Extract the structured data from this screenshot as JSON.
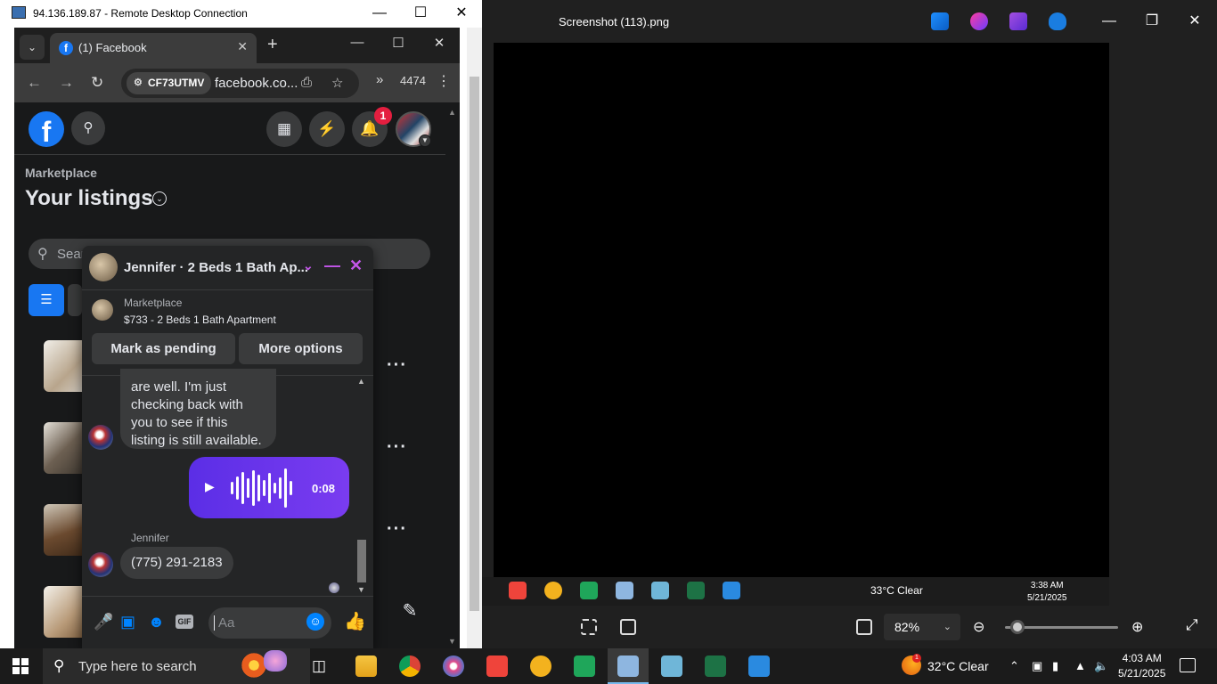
{
  "photos": {
    "title": "Screenshot (113).png",
    "zoom": "82%",
    "zoom_level": 0.1
  },
  "rdp": {
    "title": "94.136.189.87 - Remote Desktop Connection"
  },
  "chrome": {
    "tab_title": "(1) Facebook",
    "chip_label": "CF73UTMV",
    "url": "facebook.co...",
    "ext_count": "4474"
  },
  "fb": {
    "notification_count": "1",
    "breadcrumb": "Marketplace",
    "page_title": "Your listings",
    "search_placeholder": "Sear"
  },
  "chat": {
    "name": "Jennifer · 2 Beds 1 Bath Ap...",
    "marketplace_label": "Marketplace",
    "listing_title": "$733 - 2 Beds 1 Bath Apartment",
    "mark_pending": "Mark as pending",
    "more_options": "More options",
    "messages": [
      {
        "line1": "are well.  I'm just",
        "line2": "checking back with",
        "line3": "you to see if this",
        "line4": "listing is still available."
      }
    ],
    "voice_duration": "0:08",
    "sender_name": "Jennifer",
    "phone_message": "(775) 291-2183",
    "composer_placeholder": "Aa"
  },
  "inner_taskbar": {
    "weather": "33°C  Clear",
    "time": "3:38 AM",
    "date": "5/21/2025"
  },
  "taskbar": {
    "search_placeholder": "Type here to search",
    "weather": "32°C  Clear",
    "time": "4:03 AM",
    "date": "5/21/2025"
  },
  "colors": {
    "fb_blue": "#1877f2",
    "messenger_purple": "#c356ea",
    "voice_gradient": "#5b2ee6",
    "badge_red": "#e41e3f"
  }
}
